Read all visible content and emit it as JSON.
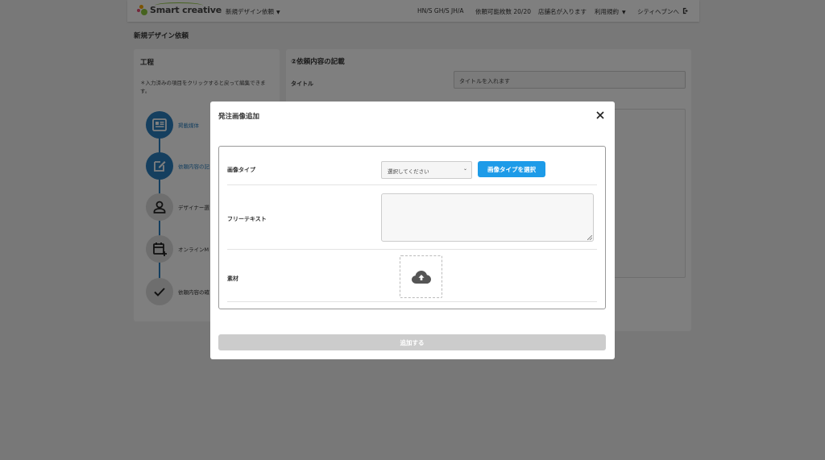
{
  "header": {
    "logo_text": "Smart creative",
    "nav_design_label": "新規デザイン依頼",
    "code_label": "HN/S GH/S JH/A",
    "request_count_label": "依頼可能枚数 20/20",
    "store_label": "店舗名が入ります",
    "terms_label": "利用規約",
    "user_label": "シティヘブンへ"
  },
  "page": {
    "title": "新規デザイン依頼"
  },
  "process_panel": {
    "heading": "工程",
    "note": "＊入力済みの項目をクリックすると戻って編集できます。",
    "steps": [
      {
        "label": "掲載媒体",
        "icon": "newspaper-icon"
      },
      {
        "label": "依頼内容の記",
        "icon": "edit-icon"
      },
      {
        "label": "デザイナー選",
        "icon": "person-icon"
      },
      {
        "label": "オンラインM",
        "icon": "calendar-add-icon"
      },
      {
        "label": "依頼内容の確",
        "icon": "check-icon"
      }
    ]
  },
  "content_panel": {
    "heading": "②依頼内容の記載",
    "title_label": "タイトル",
    "title_value": "タイトルを入れます"
  },
  "modal": {
    "title": "発注画像追加",
    "image_type_label": "画像タイプ",
    "image_type_select_value": "選択してください",
    "image_type_button": "画像タイプを選択",
    "free_text_label": "フリーテキスト",
    "free_text_value": "",
    "material_label": "素材",
    "submit_label": "追加する"
  },
  "colors": {
    "accent": "#1d9be8",
    "step_active": "#2b7fbf",
    "disabled": "#cccccc"
  }
}
